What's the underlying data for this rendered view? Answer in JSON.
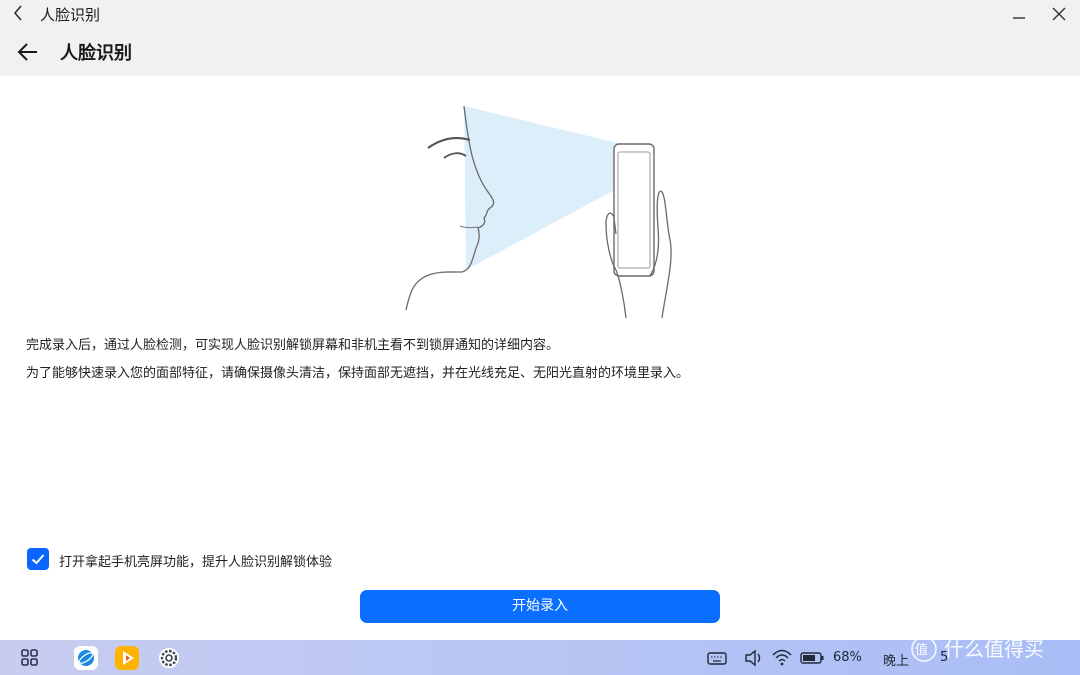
{
  "window": {
    "title": "人脸识别"
  },
  "header": {
    "title": "人脸识别"
  },
  "description": {
    "line1": "完成录入后，通过人脸检测，可实现人脸识别解锁屏幕和非机主看不到锁屏通知的详细内容。",
    "line2": "为了能够快速录入您的面部特征，请确保摄像头清洁，保持面部无遮挡，并在光线充足、无阳光直射的环境里录入。"
  },
  "option": {
    "label": "打开拿起手机亮屏功能，提升人脸识别解锁体验",
    "checked": true
  },
  "primary_button": {
    "label": "开始录入"
  },
  "taskbar": {
    "apps": [
      "app-drawer-icon",
      "browser-icon",
      "video-app-icon",
      "settings-icon"
    ],
    "tray": {
      "battery_percent": "68%",
      "time_label": "晚上",
      "time_digit": "5"
    }
  },
  "watermark": {
    "text": "值 什么值得买"
  },
  "colors": {
    "accent": "#0a6eff",
    "header_bg": "#f1f1f1",
    "beam": "#d9ecfb"
  }
}
